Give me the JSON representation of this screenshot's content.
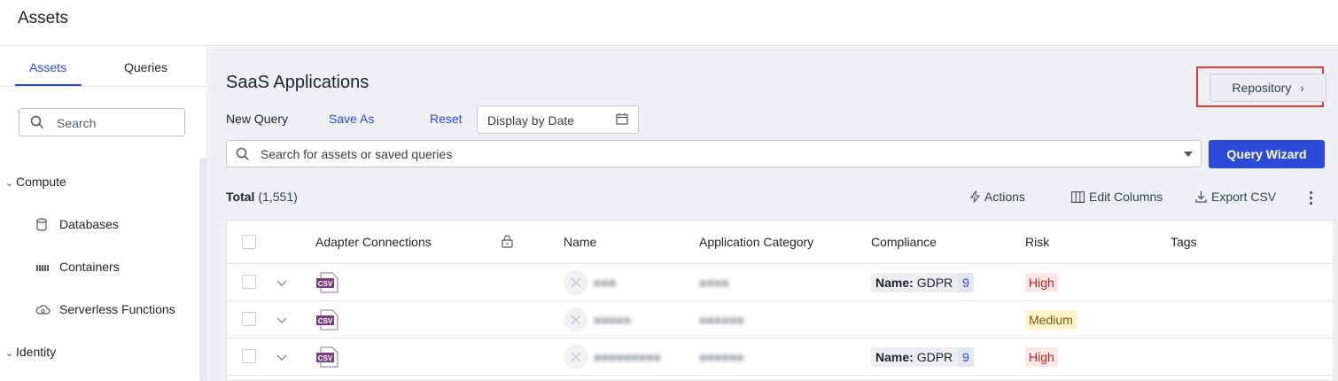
{
  "topbar": {
    "title": "Assets"
  },
  "sidebar": {
    "tabs": [
      {
        "label": "Assets"
      },
      {
        "label": "Queries"
      }
    ],
    "search_placeholder": "Search",
    "groups": [
      {
        "label": "Compute",
        "items": [
          {
            "label": "Databases",
            "icon": "database-icon"
          },
          {
            "label": "Containers",
            "icon": "containers-icon"
          },
          {
            "label": "Serverless Functions",
            "icon": "cloud-gear-icon"
          }
        ]
      },
      {
        "label": "Identity",
        "items": []
      }
    ]
  },
  "main": {
    "title": "SaaS Applications",
    "repository_label": "Repository",
    "query_bar": {
      "new_query": "New Query",
      "save_as": "Save As",
      "reset": "Reset",
      "date_placeholder": "Display by Date"
    },
    "search_placeholder": "Search for assets or saved queries",
    "wizard_label": "Query Wizard",
    "total_label": "Total",
    "total_count": "(1,551)",
    "toolbar": {
      "actions": "Actions",
      "edit_columns": "Edit Columns",
      "export_csv": "Export CSV"
    },
    "columns": [
      "Adapter Connections",
      "Name",
      "Application Category",
      "Compliance",
      "Risk",
      "Tags"
    ],
    "rows": [
      {
        "adapter": "csv",
        "compliance": {
          "key": "Name:",
          "value": "GDPR",
          "count": "9"
        },
        "risk": "High"
      },
      {
        "adapter": "csv",
        "compliance": null,
        "risk": "Medium"
      },
      {
        "adapter": "csv",
        "compliance": {
          "key": "Name:",
          "value": "GDPR",
          "count": "9"
        },
        "risk": "High"
      }
    ]
  },
  "colors": {
    "accent": "#2b4ad9",
    "high": "#b3261e",
    "medium": "#7a5a00",
    "highlight": "#e03b3b"
  }
}
